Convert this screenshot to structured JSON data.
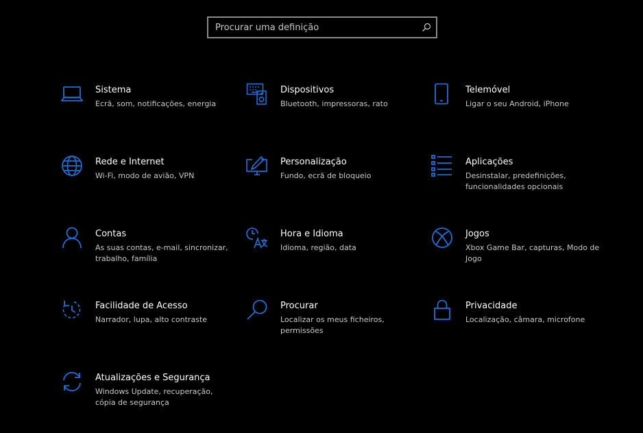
{
  "search": {
    "placeholder": "Procurar uma definição"
  },
  "colors": {
    "accent": "#1f6fd6",
    "background": "#000000",
    "title": "#ffffff",
    "description": "#c8c8c8"
  },
  "tiles": [
    {
      "icon": "laptop-icon",
      "title": "Sistema",
      "desc": "Ecrã, som, notificações, energia"
    },
    {
      "icon": "keyboard-speaker-icon",
      "title": "Dispositivos",
      "desc": "Bluetooth, impressoras, rato"
    },
    {
      "icon": "phone-icon",
      "title": "Telemóvel",
      "desc": "Ligar o seu Android, iPhone"
    },
    {
      "icon": "globe-icon",
      "title": "Rede e Internet",
      "desc": "Wi-Fi, modo de avião, VPN"
    },
    {
      "icon": "paint-monitor-icon",
      "title": "Personalização",
      "desc": "Fundo, ecrã de bloqueio"
    },
    {
      "icon": "apps-list-icon",
      "title": "Aplicações",
      "desc": "Desinstalar, predefinições, funcionalidades opcionais"
    },
    {
      "icon": "person-icon",
      "title": "Contas",
      "desc": "As suas contas, e-mail, sincronizar, trabalho, família"
    },
    {
      "icon": "time-language-icon",
      "title": "Hora e Idioma",
      "desc": "Idioma, região, data"
    },
    {
      "icon": "xbox-icon",
      "title": "Jogos",
      "desc": "Xbox Game Bar, capturas, Modo de Jogo"
    },
    {
      "icon": "ease-of-access-icon",
      "title": "Facilidade de Acesso",
      "desc": "Narrador, lupa, alto contraste"
    },
    {
      "icon": "search-icon",
      "title": "Procurar",
      "desc": "Localizar os meus ficheiros, permissões"
    },
    {
      "icon": "lock-icon",
      "title": "Privacidade",
      "desc": "Localização, câmara, microfone"
    },
    {
      "icon": "sync-icon",
      "title": "Atualizações e Segurança",
      "desc": "Windows Update, recuperação, cópia de segurança"
    }
  ]
}
